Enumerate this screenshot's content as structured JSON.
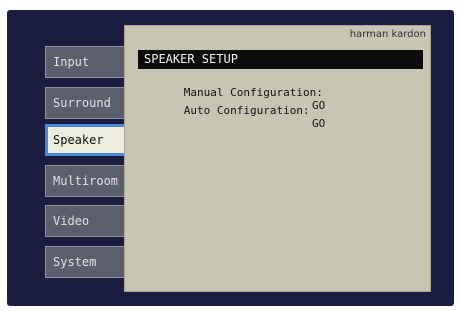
{
  "nav": {
    "items": [
      {
        "label": "Input",
        "active": false
      },
      {
        "label": "Surround",
        "active": false
      },
      {
        "label": "Speaker",
        "active": true
      },
      {
        "label": "Multiroom",
        "active": false
      },
      {
        "label": "Video",
        "active": false
      },
      {
        "label": "System",
        "active": false
      }
    ]
  },
  "panel": {
    "brand": "harman kardon",
    "title": "SPEAKER SETUP",
    "options": [
      {
        "label": "Manual Configuration:",
        "value": "GO"
      },
      {
        "label": "Auto Configuration:",
        "value": "GO"
      }
    ]
  },
  "colors": {
    "screen_background": "#1a1d3f",
    "panel_background": "#c8c6b3",
    "active_border": "#4f8bdc",
    "nav_item_background": "#5b5e6c"
  }
}
